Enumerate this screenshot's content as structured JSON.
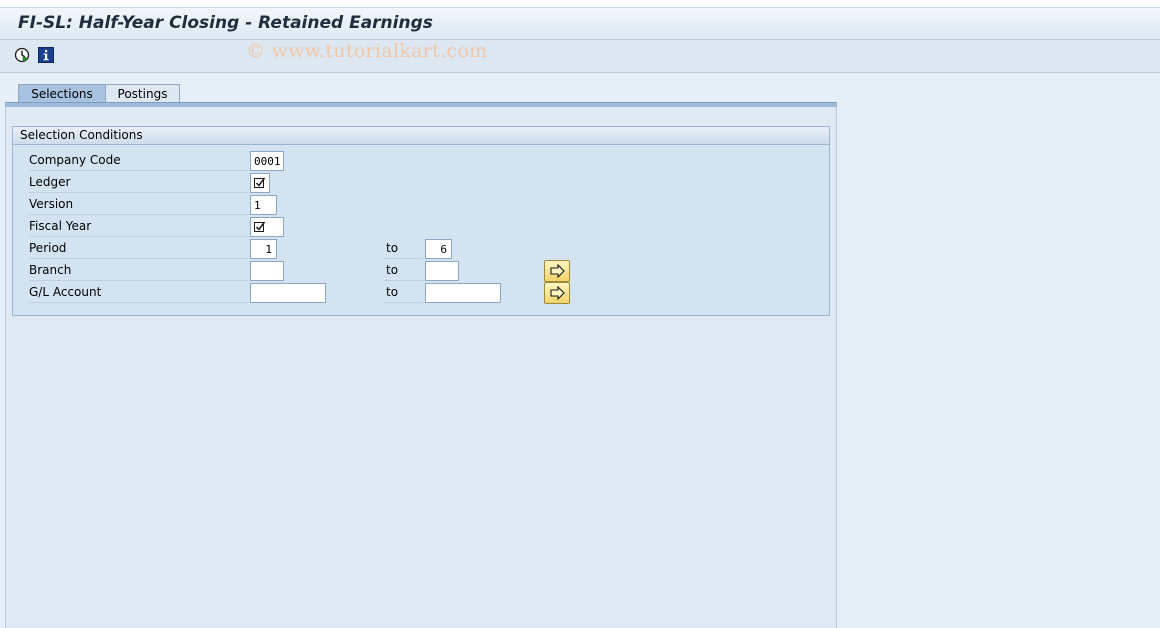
{
  "window": {
    "title": "FI-SL: Half-Year Closing - Retained Earnings"
  },
  "toolbar": {
    "icons": [
      "execute-icon",
      "info-icon"
    ]
  },
  "watermark": "© www.tutorialkart.com",
  "tabs": [
    {
      "label": "Selections",
      "active": true
    },
    {
      "label": "Postings",
      "active": false
    }
  ],
  "selection_conditions": {
    "header": "Selection Conditions",
    "fields": {
      "company_code": {
        "label": "Company Code",
        "value": "0001"
      },
      "ledger": {
        "label": "Ledger",
        "value": "",
        "checked": true
      },
      "version": {
        "label": "Version",
        "value": "1"
      },
      "fiscal_year": {
        "label": "Fiscal Year",
        "value": "",
        "checked": true
      },
      "period": {
        "label": "Period",
        "from": "1",
        "to_label": "to",
        "to": "6"
      },
      "branch": {
        "label": "Branch",
        "from": "",
        "to_label": "to",
        "to": ""
      },
      "gl_account": {
        "label": "G/L Account",
        "from": "",
        "to_label": "to",
        "to": ""
      }
    }
  },
  "colors": {
    "background": "#e6eef7",
    "active_tab": "#a7c3e0",
    "group_bg": "#d3e3f2",
    "multisel_button": "#f0d46a"
  }
}
